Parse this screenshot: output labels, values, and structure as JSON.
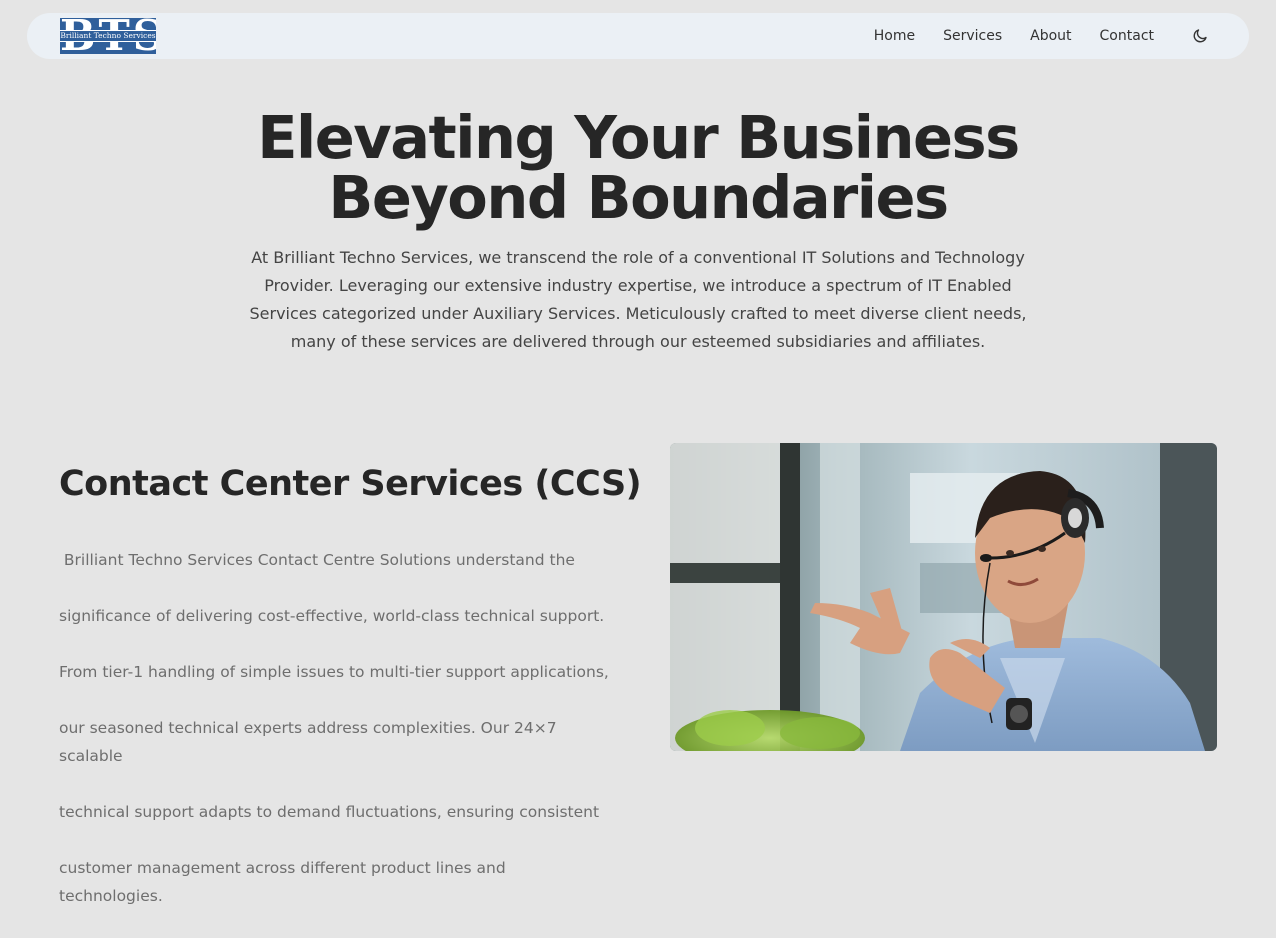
{
  "header": {
    "logo": {
      "letters": "BTS",
      "subtitle": "Brilliant Techno Services"
    },
    "nav": {
      "home": "Home",
      "services": "Services",
      "about": "About",
      "contact": "Contact"
    },
    "theme_toggle_icon": "moon-icon"
  },
  "hero": {
    "title_line1": "Elevating Your Business",
    "title_line2": "Beyond Boundaries",
    "description_line1": "At Brilliant Techno Services, we transcend the role of a conventional IT Solutions and Technology",
    "description_line2": "Provider. Leveraging our extensive industry expertise, we introduce a spectrum of IT Enabled",
    "description_line3": "Services categorized under Auxiliary Services. Meticulously crafted to meet diverse client needs,",
    "description_line4": "many of these services are delivered through our esteemed subsidiaries and affiliates."
  },
  "ccs": {
    "title": "Contact Center Services (CCS)",
    "line1": " Brilliant Techno Services Contact Centre Solutions understand the",
    "line2": "significance of delivering cost-effective, world-class technical support.",
    "line3": "From tier-1 handling of simple issues to multi-tier support applications,",
    "line4": "our seasoned technical experts address complexities. Our 24×7 scalable",
    "line5": "technical support adapts to demand fluctuations, ensuring consistent",
    "line6": "customer management across different product lines and technologies.",
    "image": "contact-center-agent-photo"
  },
  "colors": {
    "page_background": "#e5e5e5",
    "navbar_background": "#ebf0f5",
    "logo_blue": "#2f5f9b",
    "heading_text": "#262626",
    "body_text": "#6e6e6e"
  }
}
